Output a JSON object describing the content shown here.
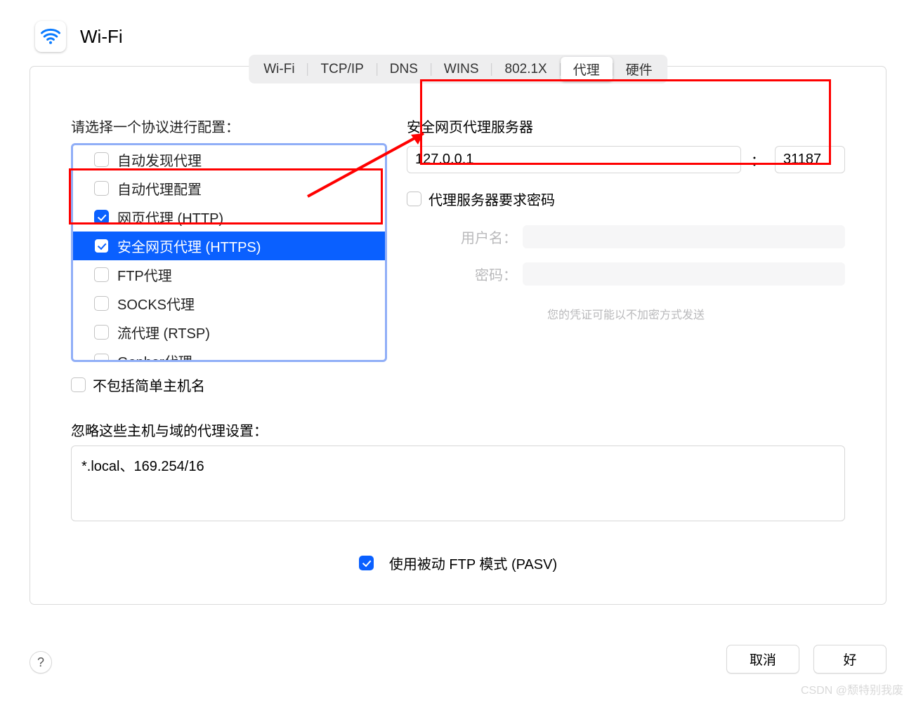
{
  "header": {
    "title": "Wi-Fi"
  },
  "tabs": [
    "Wi-Fi",
    "TCP/IP",
    "DNS",
    "WINS",
    "802.1X",
    "代理",
    "硬件"
  ],
  "tabs_selected_index": 5,
  "left": {
    "choose_label": "请选择一个协议进行配置：",
    "protocols": [
      {
        "label": "自动发现代理",
        "checked": false
      },
      {
        "label": "自动代理配置",
        "checked": false
      },
      {
        "label": "网页代理 (HTTP)",
        "checked": true
      },
      {
        "label": "安全网页代理 (HTTPS)",
        "checked": true
      },
      {
        "label": "FTP代理",
        "checked": false
      },
      {
        "label": "SOCKS代理",
        "checked": false
      },
      {
        "label": "流代理 (RTSP)",
        "checked": false
      },
      {
        "label": "Gopher代理",
        "checked": false
      }
    ],
    "selected_protocol_index": 3,
    "exclude_simple": {
      "label": "不包括简单主机名",
      "checked": false
    },
    "bypass_label": "忽略这些主机与域的代理设置：",
    "bypass_value": "*.local、169.254/16"
  },
  "right": {
    "server_label": "安全网页代理服务器",
    "host": "127.0.0.1",
    "port": "31187",
    "requires_password": {
      "label": "代理服务器要求密码",
      "checked": false
    },
    "username_label": "用户名：",
    "password_label": "密码：",
    "cred_hint": "您的凭证可能以不加密方式发送"
  },
  "pasv": {
    "label": "使用被动 FTP 模式 (PASV)",
    "checked": true
  },
  "footer": {
    "cancel": "取消",
    "ok": "好",
    "help": "?"
  },
  "watermark": "CSDN @颓特别我废"
}
